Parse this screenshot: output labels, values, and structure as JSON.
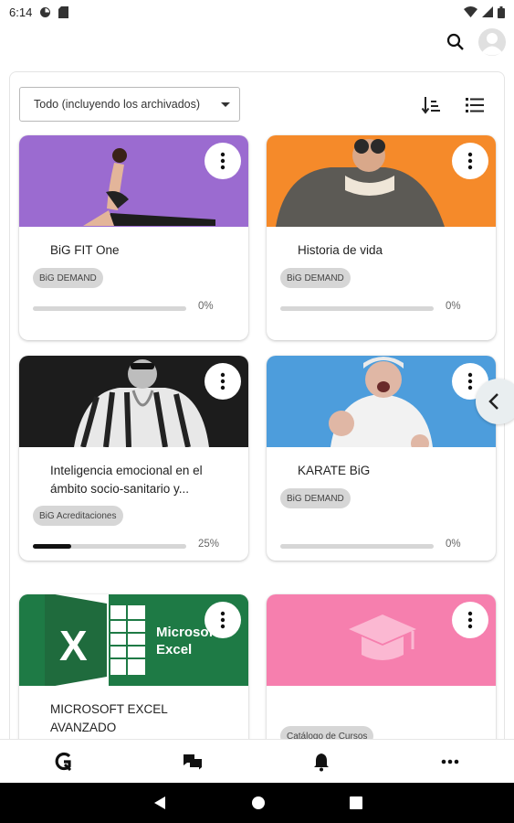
{
  "status_bar": {
    "time": "6:14"
  },
  "filter": {
    "selected": "Todo (incluyendo los archivados)"
  },
  "courses": [
    {
      "title": "BiG FIT One",
      "tag": "BiG DEMAND",
      "progress": 0,
      "progress_label": "0%",
      "banner_color": "#9b6bd0"
    },
    {
      "title": "Historia de vida",
      "tag": "BiG DEMAND",
      "progress": 0,
      "progress_label": "0%",
      "banner_color": "#f58a2a"
    },
    {
      "title": "Inteligencia emocional en el ámbito socio-sanitario y...",
      "tag": "BiG Acreditaciones",
      "progress": 25,
      "progress_label": "25%",
      "banner_color": "#1c1c1c"
    },
    {
      "title": "KARATE BiG",
      "tag": "BiG DEMAND",
      "progress": 0,
      "progress_label": "0%",
      "banner_color": "#4d9ddc"
    },
    {
      "title": "MICROSOFT EXCEL AVANZADO",
      "banner_text": "Microsoft Excel",
      "banner_color": "#1e7a45"
    },
    {
      "title": "",
      "tag": "Catálogo de Cursos",
      "banner_color": "#f67fae"
    }
  ],
  "icons": {
    "search": "search-icon",
    "avatar": "avatar-icon",
    "sort": "sort-icon",
    "list": "list-view-icon",
    "more": "more-vert-icon",
    "collapse": "chevron-left-icon",
    "nav_home": "big-logo-icon",
    "nav_chat": "chat-icon",
    "nav_notifications": "bell-icon",
    "nav_more": "more-horiz-icon"
  }
}
